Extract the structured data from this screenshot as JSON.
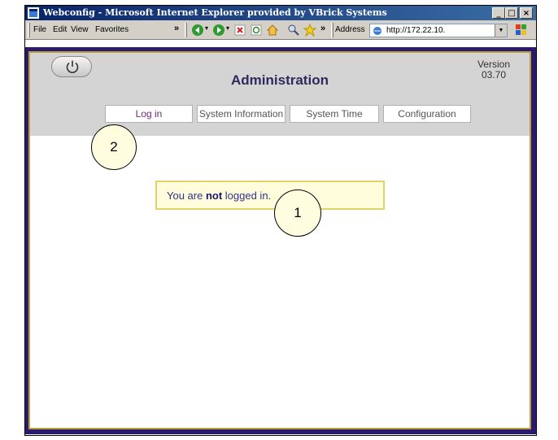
{
  "window": {
    "title": "Webconfig - Microsoft Internet Explorer provided by VBrick Systems",
    "btn_minimize": "_",
    "btn_maximize": "□",
    "btn_close": "×"
  },
  "menu": {
    "items": [
      "File",
      "Edit",
      "View",
      "Favorites"
    ],
    "overflow": "»"
  },
  "toolbar": {
    "overflow": "»",
    "address_label": "Address",
    "address_value": "http://172.22.10."
  },
  "page": {
    "title": "Administration",
    "version_label": "Version",
    "version_value": "03.70",
    "tabs": [
      {
        "label": "Log in",
        "active": true
      },
      {
        "label": "System Information",
        "active": false
      },
      {
        "label": "System Time",
        "active": false
      },
      {
        "label": "Configuration",
        "active": false
      }
    ],
    "message_prefix": "You are ",
    "message_bold": "not",
    "message_suffix": " logged in."
  },
  "callouts": [
    "1",
    "2"
  ],
  "colors": {
    "titlebar": "#0a246a",
    "page_frame": "#2b1a6e",
    "page_border": "#b7a33a",
    "header_bg": "#d4d4d4",
    "message_bg": "#fffddc"
  }
}
